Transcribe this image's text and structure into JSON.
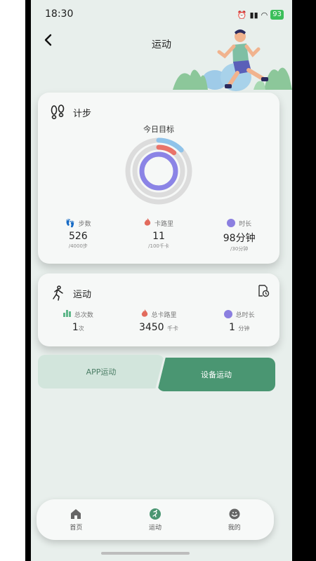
{
  "status": {
    "time": "18:30",
    "battery": "93"
  },
  "header": {
    "title": "运动"
  },
  "steps_card": {
    "title": "计步",
    "goal_label": "今日目标",
    "stats": [
      {
        "label": "步数",
        "value": "526",
        "sub": "/4000步",
        "icon": "footprint-icon",
        "color": "#8fb0e8"
      },
      {
        "label": "卡路里",
        "value": "11",
        "sub": "/100千卡",
        "icon": "flame-icon",
        "color": "#e26b5d"
      },
      {
        "label": "时长",
        "value": "98分钟",
        "sub": "/30分钟",
        "icon": "clock-icon",
        "color": "#8b7fe0"
      }
    ],
    "ring_progress": {
      "steps": 0.13,
      "calories": 0.11,
      "duration": 1.0
    }
  },
  "sport_card": {
    "title": "运动",
    "stats": [
      {
        "label": "总次数",
        "value": "1",
        "unit": "次",
        "icon": "bar-chart-icon",
        "color": "#5fb78a"
      },
      {
        "label": "总卡路里",
        "value": "3450",
        "unit": "千卡",
        "icon": "flame-icon",
        "color": "#e26b5d"
      },
      {
        "label": "总时长",
        "value": "1",
        "unit": "分钟",
        "icon": "clock-icon",
        "color": "#8b7fe0"
      }
    ]
  },
  "buttons": {
    "app_sport": "APP运动",
    "device_sport": "设备运动"
  },
  "tabbar": {
    "items": [
      {
        "label": "首页",
        "icon": "home-icon"
      },
      {
        "label": "运动",
        "icon": "runner-icon"
      },
      {
        "label": "我的",
        "icon": "profile-icon"
      }
    ]
  },
  "colors": {
    "accent": "#4a9672",
    "accent_light": "#d2e5dc"
  }
}
